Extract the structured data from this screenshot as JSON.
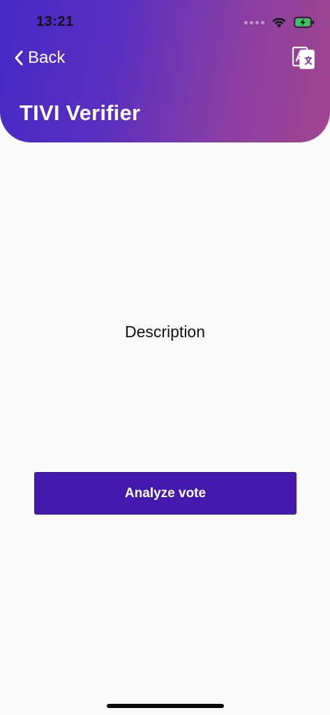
{
  "status_bar": {
    "time": "13:21",
    "icons": [
      "signal-dots-icon",
      "wifi-icon",
      "battery-charging-icon"
    ]
  },
  "header": {
    "back_label": "Back",
    "back_icon": "chevron-left-icon",
    "translate_icon": "translate-icon",
    "title": "TIVI Verifier"
  },
  "main": {
    "description": "Description",
    "analyze_label": "Analyze vote"
  },
  "colors": {
    "gradient_start": "#4429c6",
    "gradient_end": "#a1448e",
    "button": "#4419ab",
    "background": "#fafafa"
  }
}
